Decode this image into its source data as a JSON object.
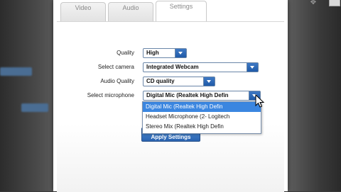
{
  "tabs": [
    {
      "label": "Video"
    },
    {
      "label": "Audio"
    },
    {
      "label": "Settings"
    }
  ],
  "form": {
    "quality": {
      "label": "Quality",
      "value": "High"
    },
    "camera": {
      "label": "Select camera",
      "value": "Integrated Webcam"
    },
    "audio_quality": {
      "label": "Audio Quality",
      "value": "CD quality"
    },
    "microphone": {
      "label": "Select microphone",
      "value": "Digital Mic (Realtek High Defin"
    }
  },
  "microphone_options": [
    "Digital Mic (Realtek High Defin",
    "Headset Microphone (2- Logitech",
    "Stereo Mix (Realtek High Defin"
  ],
  "apply_label": "Apply Settings",
  "colors": {
    "accent": "#2a63b0",
    "selected": "#3b86e0"
  }
}
